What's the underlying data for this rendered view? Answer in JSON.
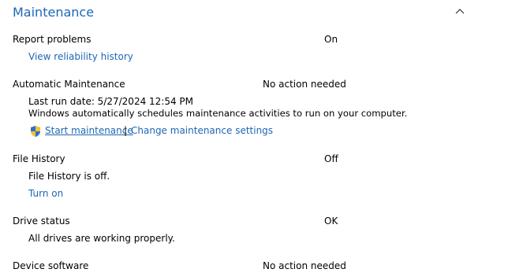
{
  "section": {
    "title": "Maintenance",
    "collapse_icon": "chevron-up-icon"
  },
  "report_problems": {
    "label": "Report problems",
    "status": "On",
    "link": "View reliability history"
  },
  "automatic_maintenance": {
    "label": "Automatic Maintenance",
    "status": "No action needed",
    "last_run": "Last run date: 5/27/2024 12:54 PM",
    "description": "Windows automatically schedules maintenance activities to run on your computer.",
    "start_link": "Start maintenance",
    "separator": "|",
    "settings_link": "Change maintenance settings",
    "shield_icon": "uac-shield-icon"
  },
  "file_history": {
    "label": "File History",
    "status": "Off",
    "description": "File History is off.",
    "link": "Turn on"
  },
  "drive_status": {
    "label": "Drive status",
    "status": "OK",
    "description": "All drives are working properly."
  },
  "device_software": {
    "label": "Device software",
    "status": "No action needed"
  },
  "colors": {
    "link": "#1e66b5",
    "text": "#000000",
    "background": "#ffffff"
  }
}
